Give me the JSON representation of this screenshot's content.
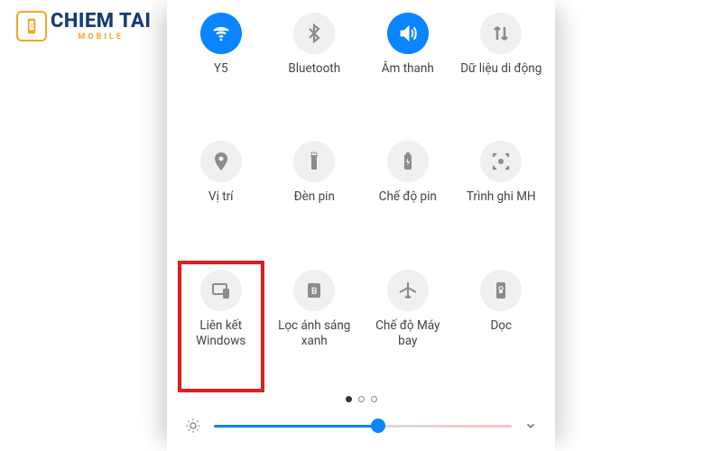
{
  "watermark": {
    "main": "CHIEM TAI",
    "sub": "MOBILE"
  },
  "colors": {
    "accent": "#0a84ff",
    "highlight": "#e31b1b",
    "inactive_bg": "#eef0f2",
    "icon_gray": "#8c8c8c"
  },
  "tiles": [
    {
      "id": "wifi",
      "label": "Y5",
      "icon": "wifi-icon",
      "active": true,
      "highlighted": false
    },
    {
      "id": "bluetooth",
      "label": "Bluetooth",
      "icon": "bluetooth-icon",
      "active": false,
      "highlighted": false
    },
    {
      "id": "sound",
      "label": "Âm thanh",
      "icon": "speaker-icon",
      "active": true,
      "highlighted": false
    },
    {
      "id": "mobiledata",
      "label": "Dữ liệu di động",
      "icon": "mobile-data-icon",
      "active": false,
      "highlighted": false
    },
    {
      "id": "location",
      "label": "Vị trí",
      "icon": "location-icon",
      "active": false,
      "highlighted": false
    },
    {
      "id": "flashlight",
      "label": "Đèn pin",
      "icon": "flashlight-icon",
      "active": false,
      "highlighted": false
    },
    {
      "id": "battery",
      "label": "Chế độ pin",
      "icon": "battery-saver-icon",
      "active": false,
      "highlighted": false
    },
    {
      "id": "screenrec",
      "label": "Trình ghi MH",
      "icon": "screen-recorder-icon",
      "active": false,
      "highlighted": false
    },
    {
      "id": "linkwindows",
      "label": "Liên kết Windows",
      "icon": "link-to-windows-icon",
      "active": false,
      "highlighted": true
    },
    {
      "id": "bluelight",
      "label": "Lọc ánh sáng xanh",
      "icon": "blue-light-icon",
      "active": false,
      "highlighted": false
    },
    {
      "id": "airplane",
      "label": "Chế độ Máy bay",
      "icon": "airplane-icon",
      "active": false,
      "highlighted": false
    },
    {
      "id": "portrait",
      "label": "Dọc",
      "icon": "portrait-lock-icon",
      "active": false,
      "highlighted": false
    }
  ],
  "pager": {
    "total": 3,
    "active_index": 0
  },
  "brightness": {
    "value_percent": 55
  }
}
